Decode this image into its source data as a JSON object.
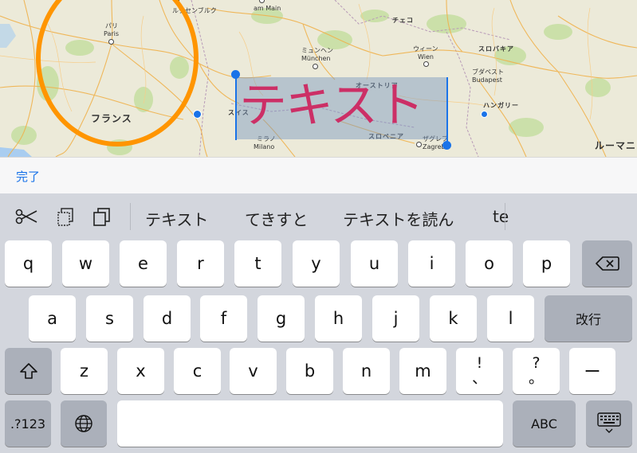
{
  "map": {
    "cities": {
      "paris_jp": "パリ",
      "paris": "Paris",
      "luxembourg": "ルクセンブルク",
      "frankfurt": "am Main",
      "czech": "チェコ",
      "vienna_jp": "ウィーン",
      "vienna": "Wien",
      "munich_jp": "ミュンヘン",
      "munich": "München",
      "slovakia": "スロバキア",
      "budapest_jp": "ブダペスト",
      "budapest": "Budapest",
      "austria": "オーストリア",
      "hungary": "ハンガリー",
      "swiss": "スイス",
      "milano_jp": "ミラノ",
      "milano": "Milano",
      "slovenia": "スロベニア",
      "zagreb_jp": "ザグレブ",
      "zagreb": "Zagreb",
      "france": "フランス",
      "romania": "ルーマニ"
    },
    "annotation_text": "テキスト",
    "colors": {
      "circle": "#ff9500",
      "annotation_text": "#cc2f66",
      "selection": "#1a73e8"
    }
  },
  "toolbar": {
    "done_label": "完了"
  },
  "suggestions": {
    "tools": [
      "scissors-icon",
      "copy-icon",
      "paste-icon"
    ],
    "items": [
      "テキスト",
      "てきすと",
      "テキストを読ん",
      "te"
    ]
  },
  "keyboard": {
    "row1": [
      "q",
      "w",
      "e",
      "r",
      "t",
      "y",
      "u",
      "i",
      "o",
      "p"
    ],
    "row2": [
      "a",
      "s",
      "d",
      "f",
      "g",
      "h",
      "j",
      "k",
      "l"
    ],
    "return_label": "改行",
    "row3": [
      "z",
      "x",
      "c",
      "v",
      "b",
      "n",
      "m"
    ],
    "exclaim_top": "!",
    "exclaim_bottom": "、",
    "question_top": "?",
    "question_bottom": "。",
    "dash": "ー",
    "numbers_label": ".?123",
    "abc_label": "ABC"
  }
}
